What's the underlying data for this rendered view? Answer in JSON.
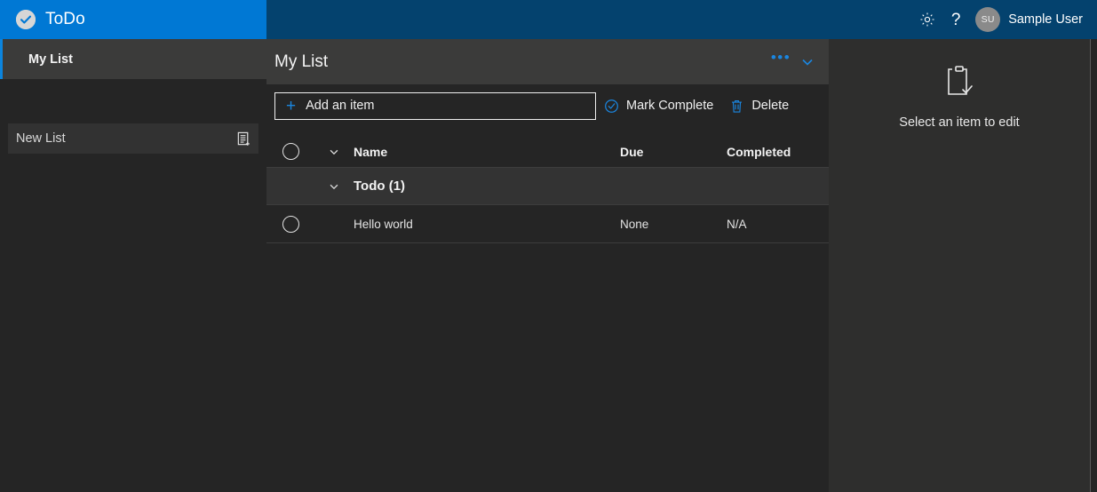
{
  "app": {
    "brand_name": "ToDo",
    "brand_icon": "check-circle-icon",
    "accent_blue": "#0078d4",
    "header_blue": "#04426e"
  },
  "topbar": {
    "settings_icon": "gear-icon",
    "help_icon": "question-mark-icon",
    "avatar_initials": "SU",
    "user_name": "Sample User"
  },
  "sidebar": {
    "items": [
      {
        "label": "My List",
        "selected": true
      }
    ],
    "new_list": {
      "value": "",
      "placeholder": "New List",
      "button_icon": "add-list-icon"
    }
  },
  "main": {
    "list_title": "My List",
    "header_actions": {
      "overflow_label": "•••",
      "overflow_icon": "ellipsis-icon",
      "collapse_icon": "chevron-down-icon"
    },
    "command_bar": {
      "add_item": {
        "placeholder": "Add an item",
        "value": "",
        "icon": "plus-icon"
      },
      "mark_complete": {
        "label": "Mark Complete",
        "icon": "check-circle-outline-icon"
      },
      "delete": {
        "label": "Delete",
        "icon": "trash-icon"
      }
    },
    "table": {
      "columns": [
        "Name",
        "Due",
        "Completed"
      ],
      "select_all_icon": "circle-icon",
      "expand_icon": "chevron-down-icon",
      "groups": [
        {
          "label": "Todo (1)",
          "expand_icon": "chevron-down-icon",
          "rows": [
            {
              "select_icon": "circle-icon",
              "name": "Hello world",
              "due": "None",
              "completed": "N/A"
            }
          ]
        }
      ]
    }
  },
  "right_panel": {
    "icon": "clipboard-check-icon",
    "empty_text": "Select an item to edit"
  }
}
